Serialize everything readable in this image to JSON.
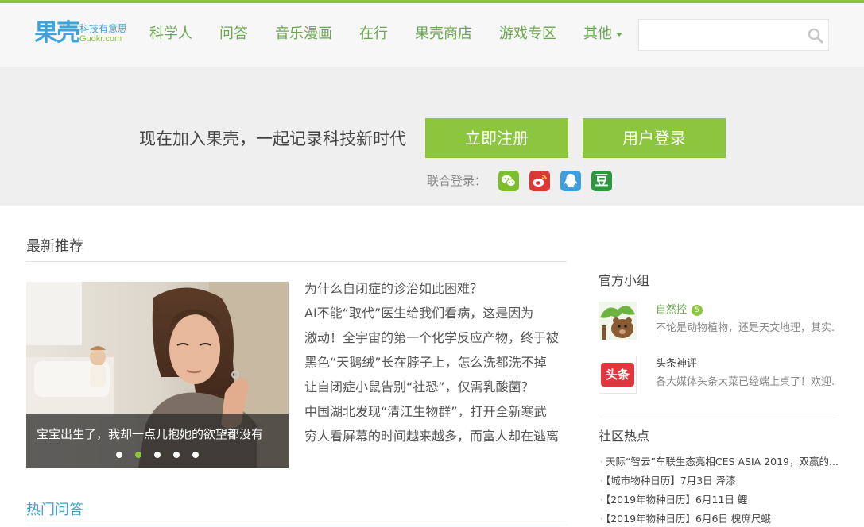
{
  "colors": {
    "brand_green": "#8cc63f",
    "brand_blue": "#3ca4d6",
    "nav_text": "#6aa84f"
  },
  "logo": {
    "main": "果壳",
    "tagline": "科技有意思",
    "domain": "Guokr.com"
  },
  "nav": {
    "items": [
      {
        "label": "科学人"
      },
      {
        "label": "问答"
      },
      {
        "label": "音乐漫画"
      },
      {
        "label": "在行"
      },
      {
        "label": "果壳商店"
      },
      {
        "label": "游戏专区"
      },
      {
        "label": "其他"
      }
    ],
    "search": {
      "placeholder": "",
      "value": "",
      "icon": "search-icon"
    }
  },
  "banner": {
    "slogan": "现在加入果壳，一起记录科技新时代",
    "register_label": "立即注册",
    "login_label": "用户登录",
    "social_label": "联合登录：",
    "social": [
      {
        "name": "wechat",
        "glyph": "",
        "color": "#7bc02c"
      },
      {
        "name": "weibo",
        "glyph": "",
        "color": "#d93a36"
      },
      {
        "name": "qq",
        "glyph": "",
        "color": "#3d9fe0"
      },
      {
        "name": "douban",
        "glyph": "豆",
        "color": "#2e963d"
      }
    ]
  },
  "latest": {
    "title": "最新推荐",
    "slider": {
      "caption": "宝宝出生了，我却一点儿抱她的欲望都没有",
      "active_index": 1,
      "count": 5
    },
    "articles": [
      "为什么自闭症的诊治如此困难？",
      "AI不能“取代”医生给我们看病，这是因为",
      "激动！全宇宙的第一个化学反应产物，终于被",
      "黑色“天鹅绒”长在脖子上，怎么洗都洗不掉",
      "让自闭症小鼠告别“社恐”，仅需乳酸菌？",
      "中国湖北发现“清江生物群”，打开全新寒武",
      "穷人看屏幕的时间越来越多，而富人却在逃离"
    ]
  },
  "hot_qa": {
    "title": "热门问答"
  },
  "sidebar": {
    "groups_title": "官方小组",
    "groups": [
      {
        "name": "自然控",
        "badge": "5",
        "desc": "不论是动物植物，还是天文地理，其实..."
      },
      {
        "name": "头条神评",
        "thumb_text": "头条",
        "desc": "各大媒体头条大菜已经端上桌了！欢迎..."
      }
    ],
    "hot_title": "社区热点",
    "hot_items": [
      "天际“智云”车联生态亮相CES ASIA 2019，双赢的...",
      "【城市物种日历】7月3日 泽漆",
      "【2019年物种日历】6月11日 鲤",
      "【2019年物种日历】6月6日 槐庶尺蛾"
    ]
  }
}
